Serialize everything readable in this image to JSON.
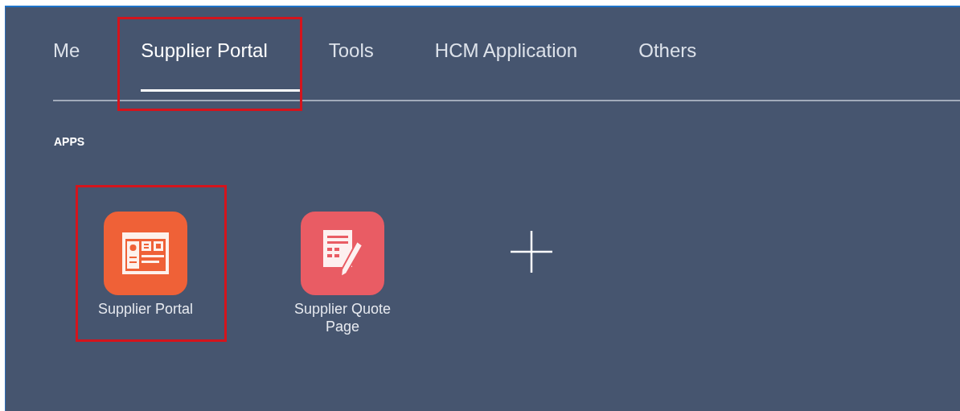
{
  "tabs": [
    {
      "label": "Me",
      "selected": false,
      "highlighted": false
    },
    {
      "label": "Supplier Portal",
      "selected": true,
      "highlighted": true
    },
    {
      "label": "Tools",
      "selected": false,
      "highlighted": false
    },
    {
      "label": "HCM Application",
      "selected": false,
      "highlighted": false
    },
    {
      "label": "Others",
      "selected": false,
      "highlighted": false
    }
  ],
  "section_title": "APPS",
  "apps": [
    {
      "label": "Supplier Portal",
      "kind": "dashboard",
      "color": "#ef6137",
      "highlighted": true
    },
    {
      "label": "Supplier Quote Page",
      "kind": "form",
      "color": "#e95c64",
      "highlighted": false
    }
  ]
}
